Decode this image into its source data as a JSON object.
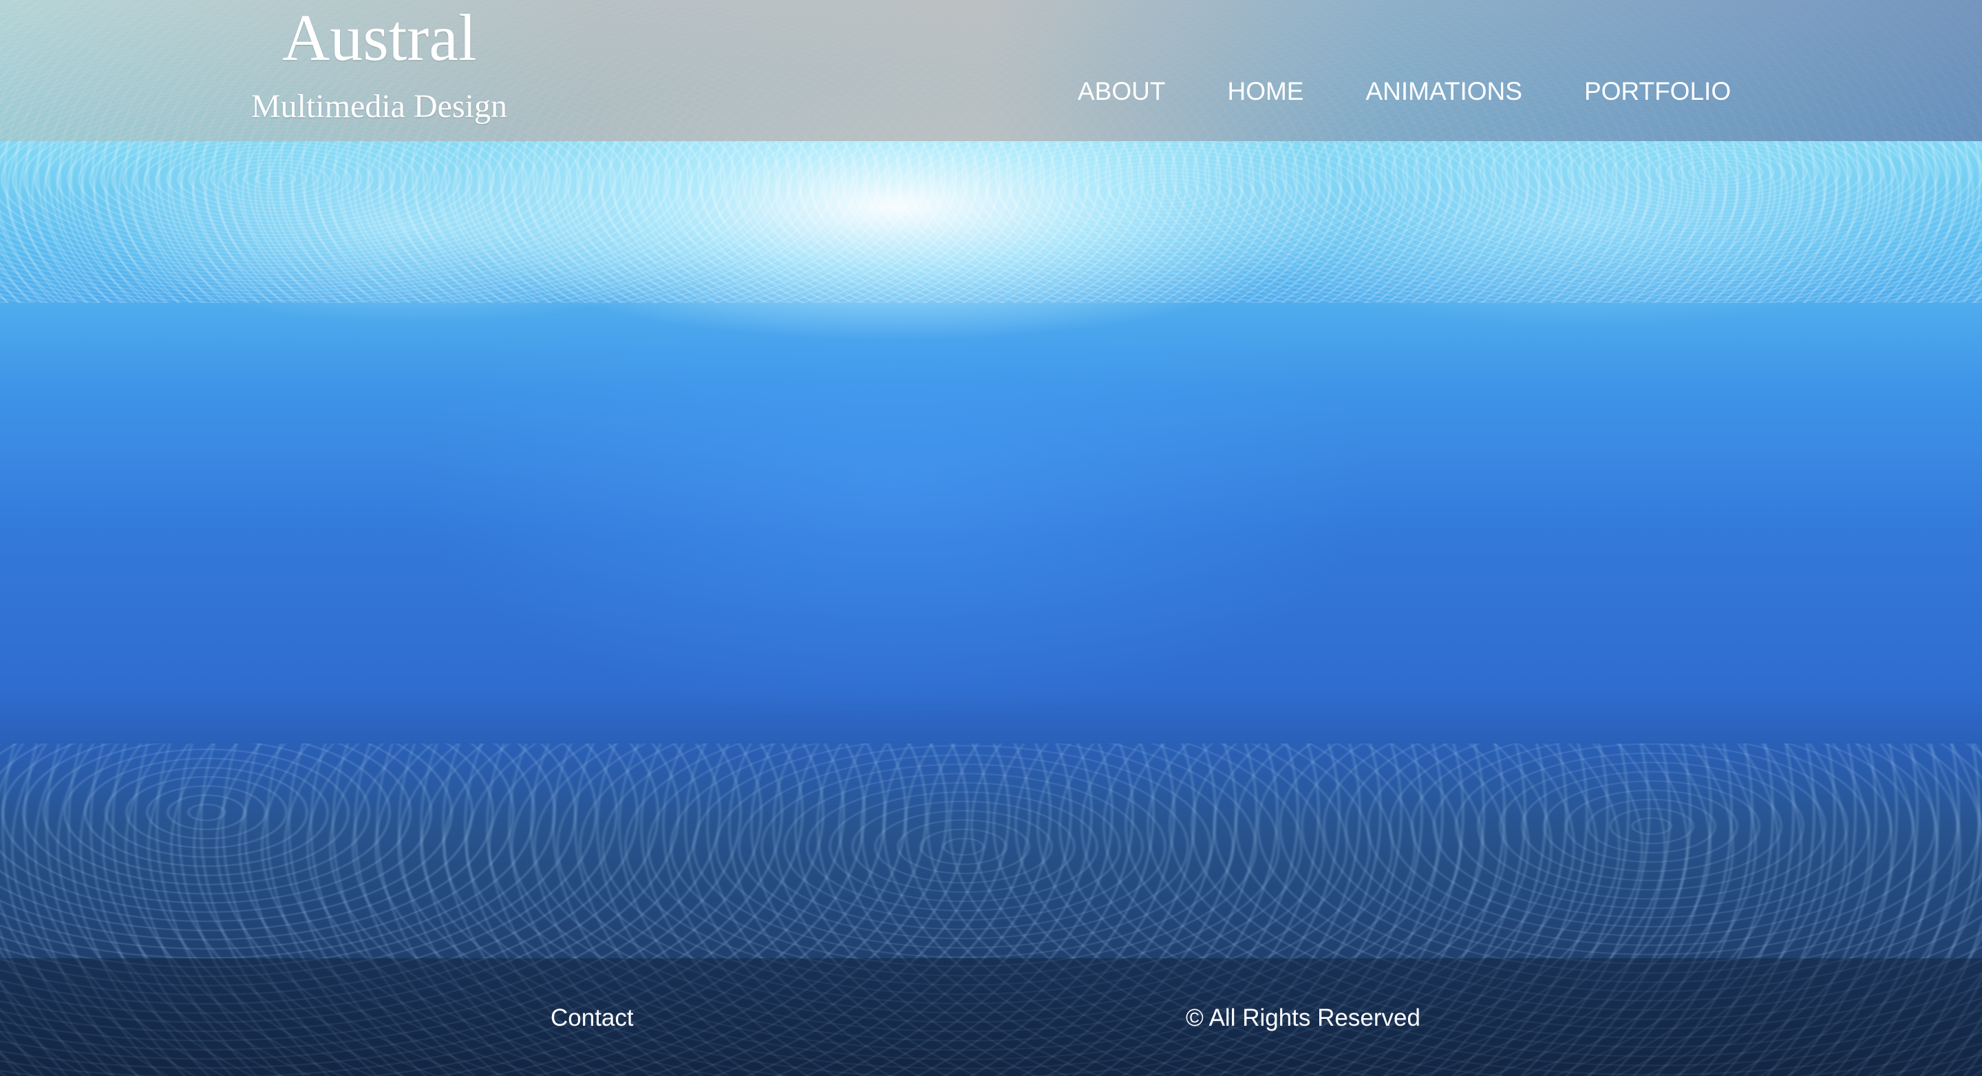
{
  "brand": {
    "title": "Austral",
    "subtitle": "Multimedia Design"
  },
  "nav": {
    "items": [
      {
        "label": "ABOUT"
      },
      {
        "label": "HOME"
      },
      {
        "label": "ANIMATIONS"
      },
      {
        "label": "PORTFOLIO"
      }
    ]
  },
  "footer": {
    "contact_label": "Contact",
    "rights_text": "© All Rights Reserved"
  },
  "colors": {
    "text": "#ffffff",
    "water_top": "#bfeefc",
    "water_mid": "#3379da",
    "water_bottom": "#162b4d",
    "header_bar": "#b9b9b9"
  }
}
